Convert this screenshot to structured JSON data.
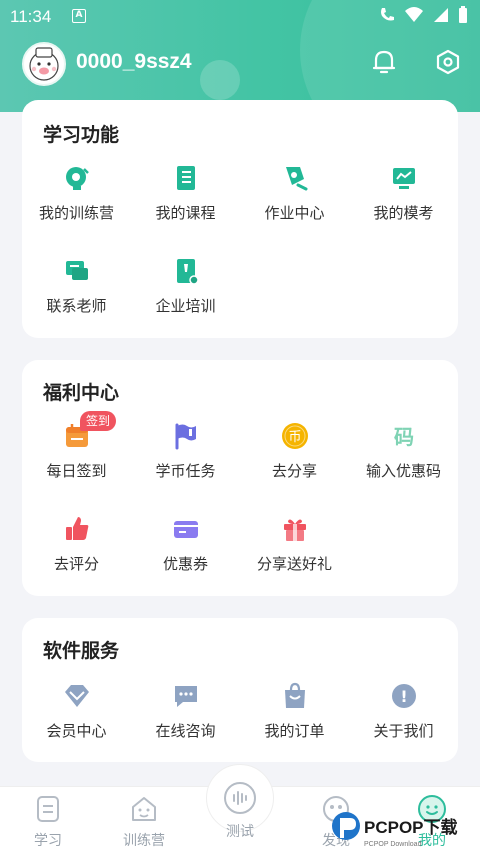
{
  "status_bar": {
    "time": "11:34",
    "a_label": "A"
  },
  "header": {
    "username": "0000_9ssz4"
  },
  "sections": {
    "study": {
      "title": "学习功能",
      "items": [
        {
          "label": "我的训练营",
          "icon": "camp-icon"
        },
        {
          "label": "我的课程",
          "icon": "course-book-icon"
        },
        {
          "label": "作业中心",
          "icon": "homework-icon"
        },
        {
          "label": "我的模考",
          "icon": "mock-exam-icon"
        },
        {
          "label": "联系老师",
          "icon": "chat-teacher-icon"
        },
        {
          "label": "企业培训",
          "icon": "enterprise-training-icon"
        }
      ]
    },
    "welfare": {
      "title": "福利中心",
      "badge": "签到",
      "items": [
        {
          "label": "每日签到",
          "icon": "calendar-checkin-icon"
        },
        {
          "label": "学币任务",
          "icon": "flag-icon"
        },
        {
          "label": "去分享",
          "icon": "coin-icon",
          "glyph": "币"
        },
        {
          "label": "输入优惠码",
          "icon": "promo-code-icon",
          "glyph": "码"
        },
        {
          "label": "去评分",
          "icon": "thumbs-up-icon"
        },
        {
          "label": "优惠券",
          "icon": "coupon-card-icon"
        },
        {
          "label": "分享送好礼",
          "icon": "gift-icon"
        }
      ]
    },
    "service": {
      "title": "软件服务",
      "items": [
        {
          "label": "会员中心",
          "icon": "diamond-icon"
        },
        {
          "label": "在线咨询",
          "icon": "chat-dots-icon"
        },
        {
          "label": "我的订单",
          "icon": "shopping-bag-icon"
        },
        {
          "label": "关于我们",
          "icon": "info-icon",
          "glyph": "!"
        }
      ]
    }
  },
  "tabbar": {
    "items": [
      {
        "label": "学习",
        "icon": "study-tab-icon"
      },
      {
        "label": "训练营",
        "icon": "camp-house-icon"
      },
      {
        "label": "测试",
        "icon": "test-voice-icon"
      },
      {
        "label": "发现",
        "icon": "discover-icon"
      },
      {
        "label": "我的",
        "icon": "me-smile-icon"
      }
    ],
    "active_index": 4
  },
  "watermark": {
    "text": "PCPOP下载",
    "small": "PCPOP Download"
  },
  "colors": {
    "brand": "#3fc3a2",
    "badge": "#f0545f",
    "icon_teal": "#22b896",
    "flag": "#6b6fe0",
    "coin": "#f5b400",
    "thumb": "#f0545f",
    "coupon": "#8a7bf0",
    "service_icon": "#8ea3c2"
  }
}
